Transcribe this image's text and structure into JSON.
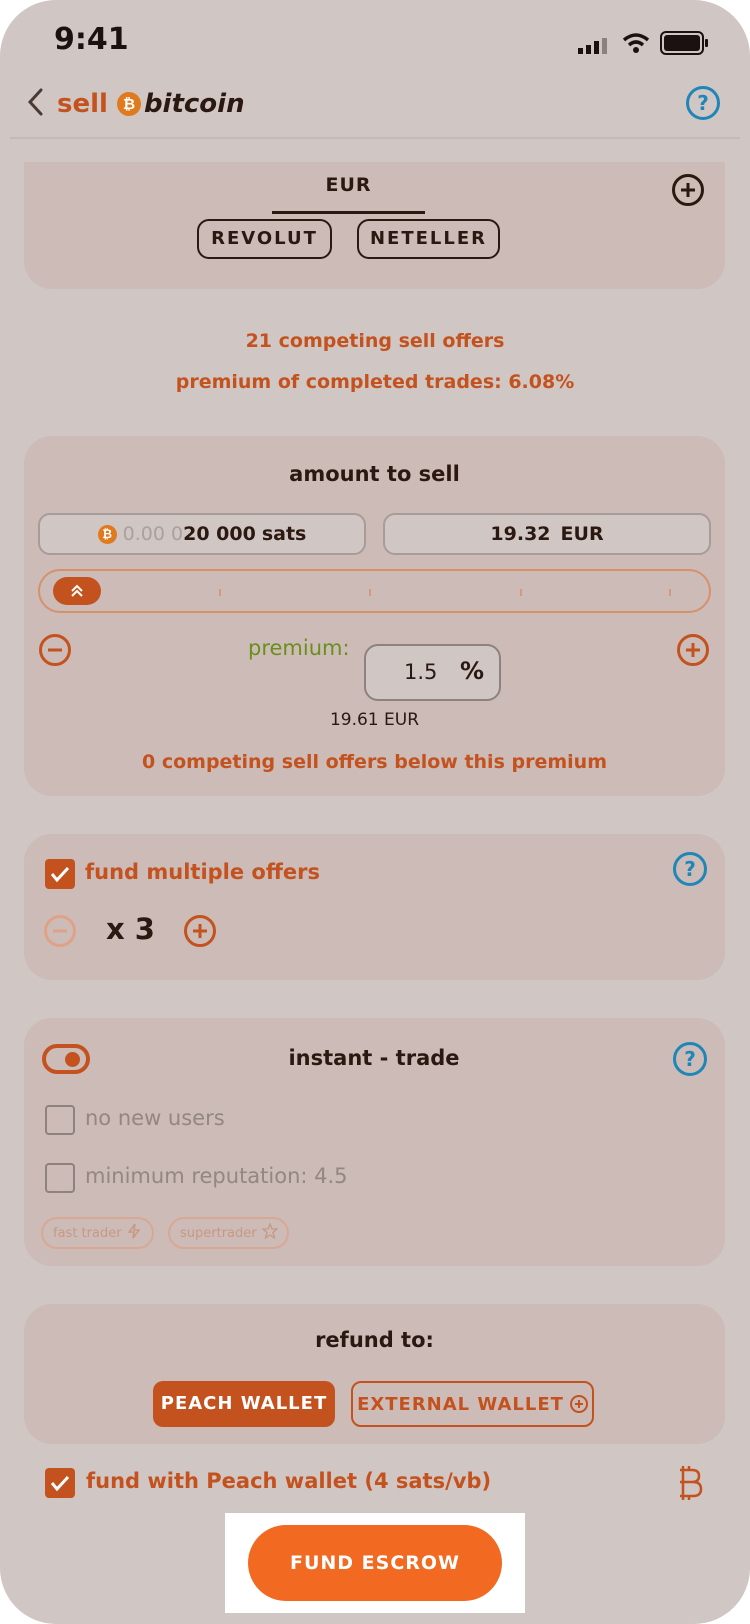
{
  "status_bar": {
    "time": "9:41"
  },
  "header": {
    "back_icon": "chevron-left-icon",
    "title_prefix": "sell",
    "title_brand": "bitcoin",
    "help_icon": "help-icon"
  },
  "currency_card": {
    "selected_currency": "EUR",
    "methods": [
      "REVOLUT",
      "NETELLER"
    ]
  },
  "market_info": {
    "competing_offers": "21 competing sell offers",
    "premium_completed": "premium of completed trades: 6.08%"
  },
  "amount": {
    "title": "amount to sell",
    "sats_prefix": "0.00 0",
    "sats_value": "20 000",
    "sats_unit": "sats",
    "fiat_value": "19.32",
    "fiat_currency": "EUR",
    "slider_fraction": 0.0,
    "premium_label": "premium:",
    "premium_value": "1.5",
    "premium_unit": "%",
    "premium_fiat": "19.61 EUR",
    "below_premium": "0 competing sell offers below this premium"
  },
  "multiple_offers": {
    "label": "fund multiple offers",
    "multiplier": "x 3"
  },
  "instant_trade": {
    "label": "instant - trade",
    "no_new_users": "no new users",
    "min_reputation": "minimum reputation: 4.5",
    "tags": [
      "fast trader",
      "supertrader"
    ]
  },
  "refund": {
    "title": "refund to:",
    "peach_wallet": "PEACH WALLET",
    "external_wallet": "EXTERNAL WALLET"
  },
  "fund_with": {
    "label": "fund with Peach wallet (4 sats/vb)"
  },
  "cta": {
    "label": "FUND ESCROW"
  },
  "colors": {
    "accent": "#c4521e",
    "cta": "#f26a22",
    "help": "#1f86b8",
    "premium_label": "#6b8f1d"
  }
}
